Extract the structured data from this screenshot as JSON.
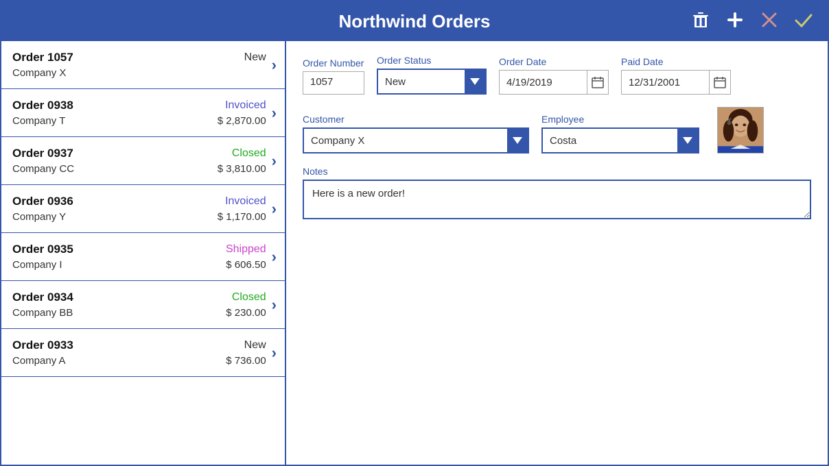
{
  "header": {
    "title": "Northwind Orders",
    "icons": {
      "delete": "🗑",
      "add": "+",
      "cancel": "✕",
      "confirm": "✓"
    }
  },
  "order_list": {
    "orders": [
      {
        "id": "order-1057",
        "number": "Order 1057",
        "status": "New",
        "status_key": "new",
        "company": "Company X",
        "amount": null
      },
      {
        "id": "order-0938",
        "number": "Order 0938",
        "status": "Invoiced",
        "status_key": "invoiced",
        "company": "Company T",
        "amount": "$ 2,870.00"
      },
      {
        "id": "order-0937",
        "number": "Order 0937",
        "status": "Closed",
        "status_key": "closed",
        "company": "Company CC",
        "amount": "$ 3,810.00"
      },
      {
        "id": "order-0936",
        "number": "Order 0936",
        "status": "Invoiced",
        "status_key": "invoiced",
        "company": "Company Y",
        "amount": "$ 1,170.00"
      },
      {
        "id": "order-0935",
        "number": "Order 0935",
        "status": "Shipped",
        "status_key": "shipped",
        "company": "Company I",
        "amount": "$ 606.50"
      },
      {
        "id": "order-0934",
        "number": "Order 0934",
        "status": "Closed",
        "status_key": "closed",
        "company": "Company BB",
        "amount": "$ 230.00"
      },
      {
        "id": "order-0933",
        "number": "Order 0933",
        "status": "New",
        "status_key": "new",
        "company": "Company A",
        "amount": "$ 736.00"
      }
    ]
  },
  "detail": {
    "fields": {
      "order_number_label": "Order Number",
      "order_number_value": "1057",
      "order_status_label": "Order Status",
      "order_status_value": "New",
      "order_date_label": "Order Date",
      "order_date_value": "4/19/2019",
      "paid_date_label": "Paid Date",
      "paid_date_value": "12/31/2001",
      "customer_label": "Customer",
      "customer_value": "Company X",
      "employee_label": "Employee",
      "employee_value": "Costa",
      "notes_label": "Notes",
      "notes_value": "Here is a new order!"
    }
  }
}
